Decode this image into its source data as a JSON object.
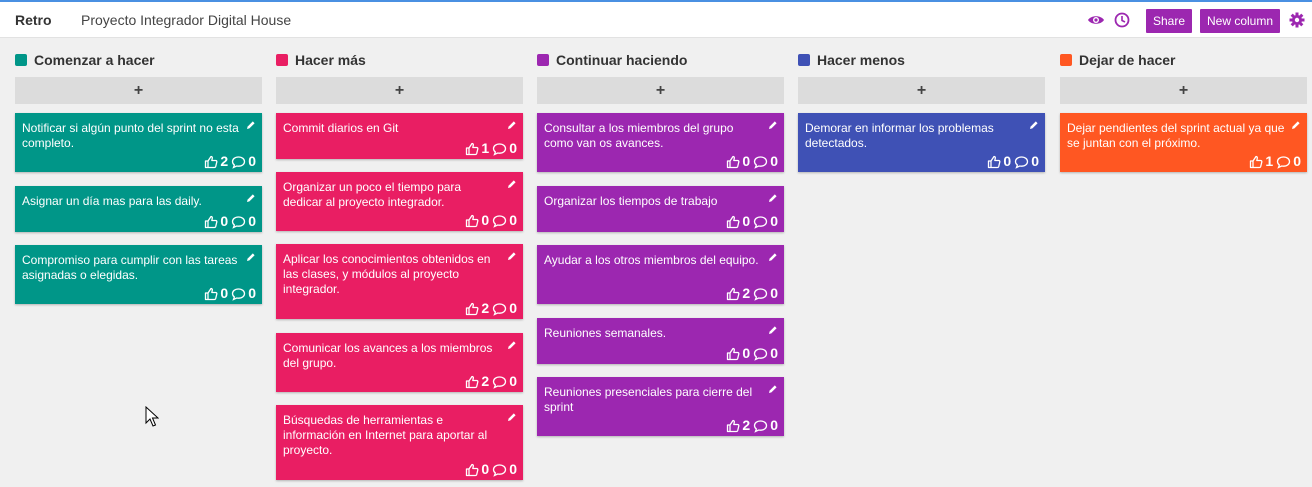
{
  "app": {
    "brand": "Retro",
    "board_title": "Proyecto Integrador Digital House"
  },
  "toolbar": {
    "view_icon": "eye-icon",
    "history_icon": "clock-icon",
    "share_label": "Share",
    "new_column_label": "New column",
    "settings_icon": "gear-icon"
  },
  "colors": {
    "accent": "#9c27b0",
    "teal": "#009688",
    "pink": "#e91e63",
    "purple": "#9c27b0",
    "indigo": "#3f51b5",
    "orange": "#ff5722"
  },
  "columns": [
    {
      "title": "Comenzar a hacer",
      "color": "#009688",
      "add_label": "+",
      "cards": [
        {
          "text": "Notificar si algún punto del sprint no esta completo.",
          "likes": "2",
          "comments": "0"
        },
        {
          "text": "Asignar un día mas para las daily.",
          "likes": "0",
          "comments": "0"
        },
        {
          "text": "Compromiso para cumplir con las tareas asignadas o elegidas.",
          "likes": "0",
          "comments": "0"
        }
      ]
    },
    {
      "title": "Hacer más",
      "color": "#e91e63",
      "add_label": "+",
      "cards": [
        {
          "text": "Commit diarios en Git",
          "likes": "1",
          "comments": "0"
        },
        {
          "text": "Organizar un poco el tiempo para dedicar al proyecto integrador.",
          "likes": "0",
          "comments": "0"
        },
        {
          "text": "Aplicar los conocimientos obtenidos en las clases, y módulos al proyecto integrador.",
          "likes": "2",
          "comments": "0"
        },
        {
          "text": "Comunicar los avances a los miembros del grupo.",
          "likes": "2",
          "comments": "0"
        },
        {
          "text": "Búsquedas de herramientas e información en Internet para aportar al proyecto.",
          "likes": "0",
          "comments": "0"
        }
      ]
    },
    {
      "title": "Continuar haciendo",
      "color": "#9c27b0",
      "add_label": "+",
      "cards": [
        {
          "text": "Consultar a los miembros del grupo como van os avances.",
          "likes": "0",
          "comments": "0"
        },
        {
          "text": "Organizar los tiempos de trabajo",
          "likes": "0",
          "comments": "0"
        },
        {
          "text": "Ayudar a los otros miembros del equipo.",
          "likes": "2",
          "comments": "0"
        },
        {
          "text": "Reuniones semanales.",
          "likes": "0",
          "comments": "0"
        },
        {
          "text": "Reuniones presenciales para cierre del sprint",
          "likes": "2",
          "comments": "0"
        }
      ]
    },
    {
      "title": "Hacer menos",
      "color": "#3f51b5",
      "add_label": "+",
      "cards": [
        {
          "text": "Demorar en informar los problemas detectados.",
          "likes": "0",
          "comments": "0"
        }
      ]
    },
    {
      "title": "Dejar de hacer",
      "color": "#ff5722",
      "add_label": "+",
      "cards": [
        {
          "text": "Dejar pendientes del sprint actual ya que se juntan con el próximo.",
          "likes": "1",
          "comments": "0"
        }
      ]
    }
  ]
}
